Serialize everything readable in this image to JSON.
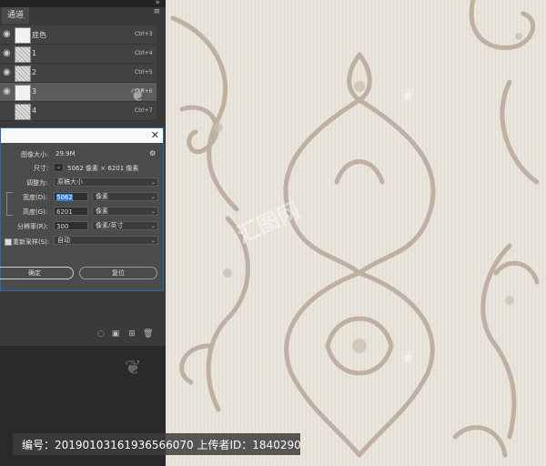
{
  "panel": {
    "tab_label": "通道",
    "channels": [
      {
        "name": "底色",
        "shortcut": "Ctrl+3",
        "thumb": "plain"
      },
      {
        "name": "1",
        "shortcut": "Ctrl+4",
        "thumb": "pattern"
      },
      {
        "name": "2",
        "shortcut": "Ctrl+5",
        "thumb": "pattern"
      },
      {
        "name": "3",
        "shortcut": "Ctrl+6",
        "thumb": "plain"
      },
      {
        "name": "4",
        "shortcut": "Ctrl+7",
        "thumb": "pattern"
      }
    ]
  },
  "dialog": {
    "image_size_label": "图像大小:",
    "image_size_value": "29.9M",
    "dimensions_label": "尺寸:",
    "dimensions_value": "5062 像素 × 6201 像素",
    "fit_label": "调整为:",
    "fit_value": "原稿大小",
    "width_label": "宽度(D):",
    "width_value": "5062",
    "width_unit": "像素",
    "height_label": "高度(G):",
    "height_value": "6201",
    "height_unit": "像素",
    "resolution_label": "分辨率(R):",
    "resolution_value": "300",
    "resolution_unit": "像素/英寸",
    "resample_label": "重新采样(S):",
    "resample_value": "自动",
    "ok_label": "确定",
    "cancel_label": "复位"
  },
  "caption": {
    "text": "编号：20190103161936566070 上传者ID：1840290"
  },
  "watermarks": [
    "汇图网"
  ],
  "colors": {
    "wallpaper_bg": "#e9e4dc",
    "ornament": "#b8a898",
    "panel_bg": "#3a3a3a",
    "dialog_border": "#1f6fb2",
    "highlight": "#2f7bd6"
  },
  "icons": [
    "eye-icon",
    "close-icon",
    "panel-menu-icon",
    "gear-icon",
    "link-chain-icon",
    "dropdown-arrow-icon",
    "new-channel-icon",
    "delete-icon",
    "save-selection-icon",
    "load-selection-icon"
  ]
}
